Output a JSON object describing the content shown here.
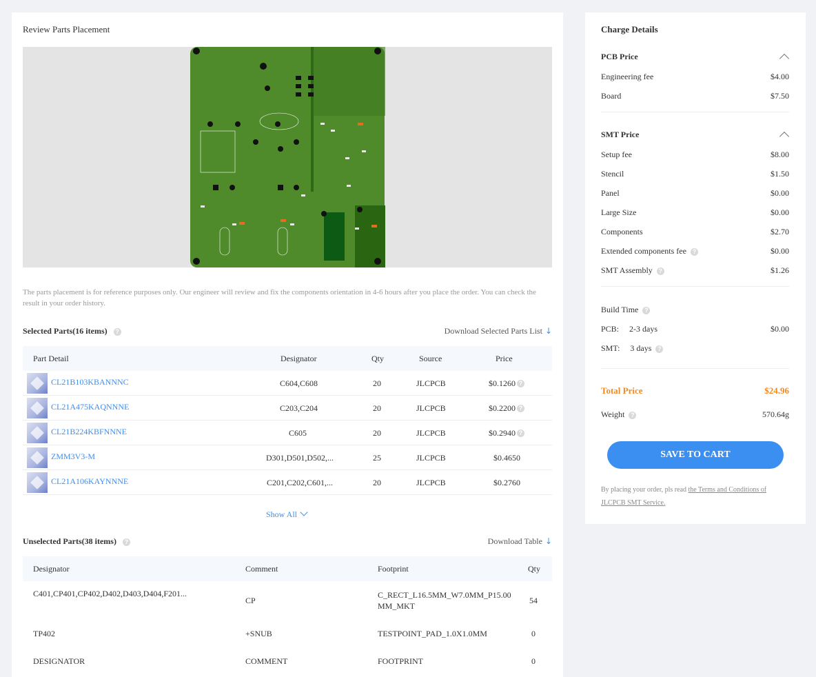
{
  "placement": {
    "title": "Review Parts Placement",
    "note": "The parts placement is for reference purposes only. Our engineer will review and fix the components orientation in 4-6 hours after you place the order. You can check the result in your order history."
  },
  "selected": {
    "header": "Selected Parts(16 items)",
    "download_label": "Download Selected Parts List",
    "columns": [
      "Part Detail",
      "Designator",
      "Qty",
      "Source",
      "Price"
    ],
    "rows": [
      {
        "part": "CL21B103KBANNNC",
        "designator": "C604,C608",
        "qty": "20",
        "source": "JLCPCB",
        "price": "$0.1260",
        "info": true
      },
      {
        "part": "CL21A475KAQNNNE",
        "designator": "C203,C204",
        "qty": "20",
        "source": "JLCPCB",
        "price": "$0.2200",
        "info": true
      },
      {
        "part": "CL21B224KBFNNNE",
        "designator": "C605",
        "qty": "20",
        "source": "JLCPCB",
        "price": "$0.2940",
        "info": true
      },
      {
        "part": "ZMM3V3-M",
        "designator": "D301,D501,D502,...",
        "qty": "25",
        "source": "JLCPCB",
        "price": "$0.4650",
        "info": false
      },
      {
        "part": "CL21A106KAYNNNE",
        "designator": "C201,C202,C601,...",
        "qty": "20",
        "source": "JLCPCB",
        "price": "$0.2760",
        "info": false
      }
    ],
    "show_all": "Show All"
  },
  "unselected": {
    "header": "Unselected Parts(38 items)",
    "download_label": "Download Table",
    "columns": [
      "Designator",
      "Comment",
      "Footprint",
      "Qty"
    ],
    "rows": [
      {
        "designator": "C401,CP401,CP402,D402,D403,D404,F201...",
        "comment": "CP",
        "footprint_line1": "C_RECT_L16.5MM_W7.0MM_P15.00",
        "footprint_line2": "MM_MKT",
        "qty": "54"
      },
      {
        "designator": "TP402",
        "comment": "+SNUB",
        "footprint_line1": "TESTPOINT_PAD_1.0X1.0MM",
        "footprint_line2": "",
        "qty": "0"
      },
      {
        "designator": "DESIGNATOR",
        "comment": "COMMENT",
        "footprint_line1": "FOOTPRINT",
        "footprint_line2": "",
        "qty": "0"
      }
    ]
  },
  "charges": {
    "title": "Charge Details",
    "pcb": {
      "label": "PCB Price",
      "items": [
        {
          "label": "Engineering fee",
          "value": "$4.00"
        },
        {
          "label": "Board",
          "value": "$7.50"
        }
      ]
    },
    "smt": {
      "label": "SMT Price",
      "items": [
        {
          "label": "Setup fee",
          "value": "$8.00"
        },
        {
          "label": "Stencil",
          "value": "$1.50"
        },
        {
          "label": "Panel",
          "value": "$0.00"
        },
        {
          "label": "Large Size",
          "value": "$0.00"
        },
        {
          "label": "Components",
          "value": "$2.70"
        },
        {
          "label": "Extended components fee",
          "value": "$0.00"
        },
        {
          "label": "SMT Assembly",
          "value": "$1.26"
        }
      ]
    },
    "build_time": {
      "label": "Build Time",
      "pcb_label": "PCB:",
      "pcb_days": "2-3 days",
      "pcb_value": "$0.00",
      "smt_label": "SMT:",
      "smt_days": "3 days"
    },
    "total_label": "Total Price",
    "total_value": "$24.96",
    "weight_label": "Weight",
    "weight_value": "570.64g",
    "cart_button": "SAVE TO CART",
    "terms_prefix": "By placing your order, pls read ",
    "terms_link": "the Terms and Conditions of JLCPCB SMT Service."
  },
  "colors": {
    "accent": "#3b8ff0",
    "total": "#f08a24",
    "pcb_green": "#4f8a2b"
  }
}
